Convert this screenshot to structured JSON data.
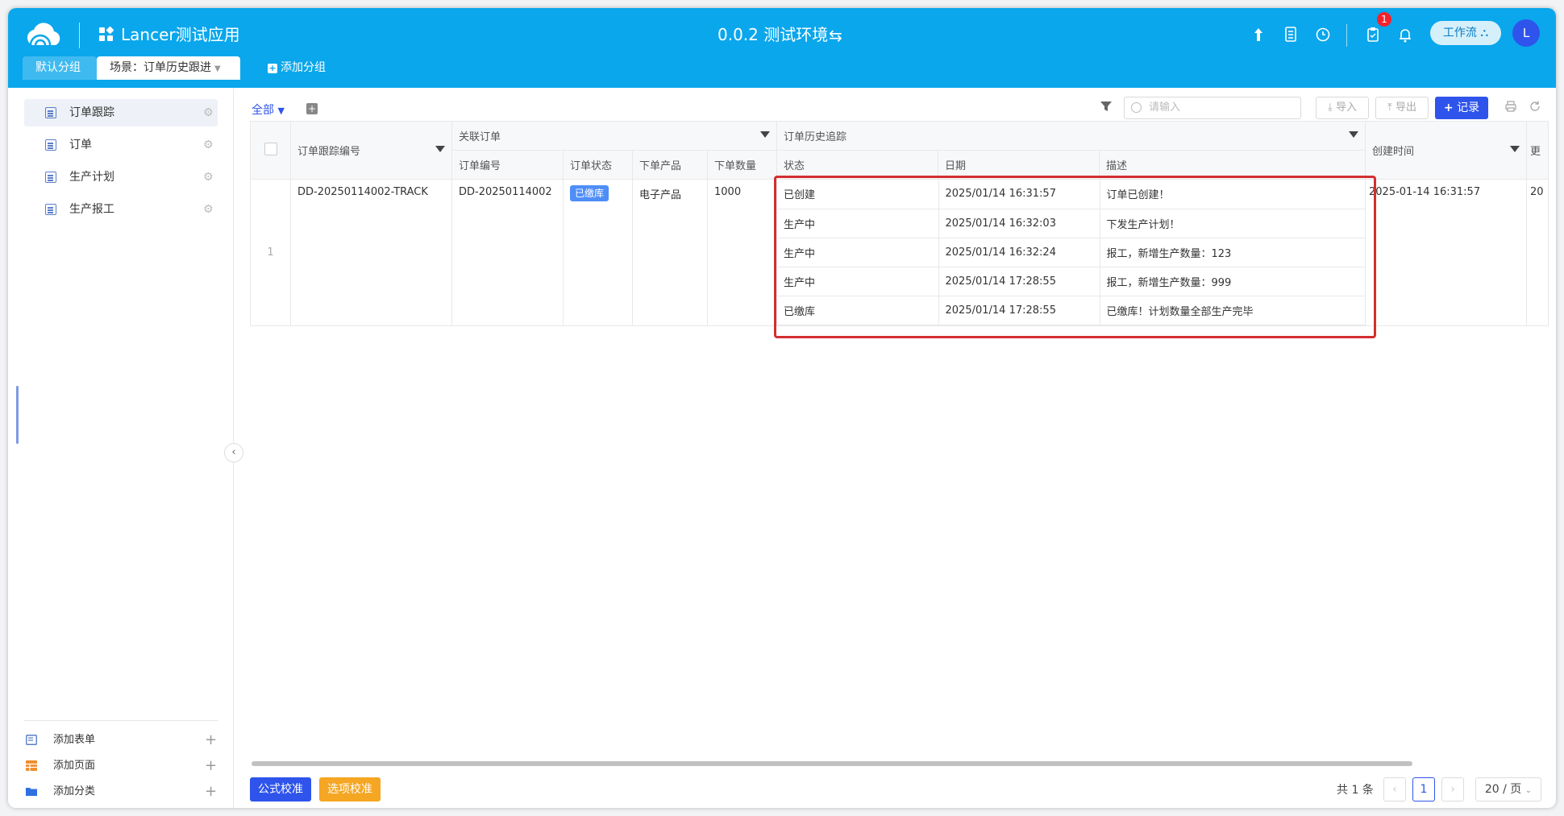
{
  "header": {
    "app_name": "Lancer测试应用",
    "environment": "0.0.2 测试环境",
    "env_switch_icon": "⇆",
    "notification_count": "1",
    "workflow_label": "工作流",
    "avatar_letter": "L"
  },
  "tabs": {
    "default_group": "默认分组",
    "scene": "场景：订单历史跟进",
    "add_group": "添加分组"
  },
  "sidebar": {
    "items": [
      {
        "label": "订单跟踪"
      },
      {
        "label": "订单"
      },
      {
        "label": "生产计划"
      },
      {
        "label": "生产报工"
      }
    ],
    "bottom": {
      "add_form": "添加表单",
      "add_page": "添加页面",
      "add_category": "添加分类"
    }
  },
  "toolbar": {
    "view_all": "全部",
    "search_placeholder": "请输入",
    "import": "导入",
    "export": "导出",
    "add_record": "记录"
  },
  "table": {
    "headers": {
      "track_no": "订单跟踪编号",
      "related_order": "关联订单",
      "order_no": "订单编号",
      "order_status": "订单状态",
      "product": "下单产品",
      "quantity": "下单数量",
      "history": "订单历史追踪",
      "h_status": "状态",
      "h_date": "日期",
      "h_desc": "描述",
      "created_time": "创建时间",
      "more": "更"
    },
    "row": {
      "index": "1",
      "track_no": "DD-20250114002-TRACK",
      "order_no": "DD-20250114002",
      "order_status": "已缴库",
      "product": "电子产品",
      "quantity": "1000",
      "created_time": "2025-01-14 16:31:57",
      "more": "20",
      "history": [
        {
          "status": "已创建",
          "date": "2025/01/14 16:31:57",
          "desc": "订单已创建！"
        },
        {
          "status": "生产中",
          "date": "2025/01/14 16:32:03",
          "desc": "下发生产计划！"
        },
        {
          "status": "生产中",
          "date": "2025/01/14 16:32:24",
          "desc": "报工，新增生产数量：123"
        },
        {
          "status": "生产中",
          "date": "2025/01/14 17:28:55",
          "desc": "报工，新增生产数量：999"
        },
        {
          "status": "已缴库",
          "date": "2025/01/14 17:28:55",
          "desc": "已缴库！计划数量全部生产完毕"
        }
      ]
    }
  },
  "footer": {
    "formula_check": "公式校准",
    "option_check": "选项校准",
    "total": "共 1 条",
    "current_page": "1",
    "page_size": "20 / 页"
  },
  "colors": {
    "topbar": "#0aa7ec",
    "primary": "#2f54eb",
    "warning": "#f5a623",
    "highlight_border": "#d32f2f"
  }
}
